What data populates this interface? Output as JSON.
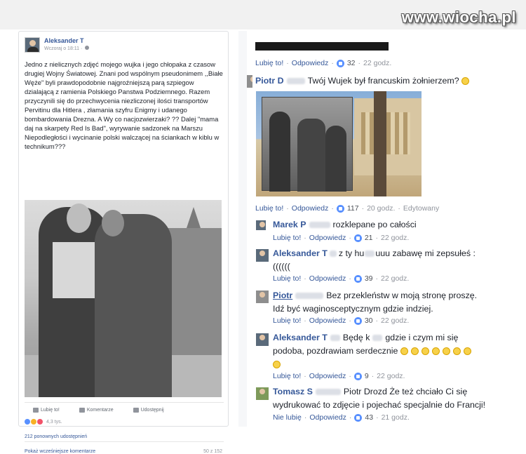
{
  "watermark": "www.wiocha.pl",
  "post": {
    "author": "Aleksander T",
    "time": "Wczoraj o 18:11 · ",
    "text": "Jedno z nielicznych zdjęć mojego wujka i jego chłopaka z czasow drugiej Wojny Światowej. Znani pod wspólnym pseudonimem ,,Białe Węże\" byli prawdopodobnie najgroźniejszą parą szpiegow dzialającą z ramienia Polskiego Panstwa Podziemnego. Razem przyczynili się do przechwycenia niezliczonej ilości transportów Pervitinu dla Hitlera , złamania szyfru Enigmy i udanego bombardowania Drezna. A Wy co nacjozwierzaki? ?? Dalej \"mama daj na skarpety Red Is Bad\", wyrywanie sadzonek na Marszu Niepodległości i wycinanie polski walczącej na ściankach w kiblu w technikum???",
    "actions": {
      "like": "Lubię to!",
      "comment": "Komentarze",
      "share": "Udostępnij"
    },
    "reactions": "4,3 tys.",
    "shares": "212 ponownych udostępnień",
    "more_comments": "Pokaż wcześniejsze komentarze",
    "pager": "50 z 152"
  },
  "comments": {
    "top_meta": {
      "like": "Lubię to!",
      "reply": "Odpowiedz",
      "count": "32",
      "time": "22 godz."
    },
    "c1": {
      "name": "Piotr D",
      "text": "Twój Wujek był francuskim żołnierzem? ",
      "meta": {
        "like": "Lubię to!",
        "reply": "Odpowiedz",
        "count": "117",
        "time": "20 godz.",
        "edited": "Edytowany"
      }
    },
    "c2": {
      "name": "Marek P",
      "text": "rozklepane po całości",
      "meta": {
        "like": "Lubię to!",
        "reply": "Odpowiedz",
        "count": "21",
        "time": "22 godz."
      }
    },
    "c3": {
      "name": "Aleksander T",
      "text_a": "z ty hu",
      "text_b": "uuu zabawę mi zepsułeś :",
      "text_c": "((((((",
      "meta": {
        "like": "Lubię to!",
        "reply": "Odpowiedz",
        "count": "39",
        "time": "22 godz."
      }
    },
    "c4": {
      "name": "Piotr",
      "text": "Bez przekleństw w moją stronę proszę.",
      "text2": "Idź być waginosceptycznym gdzie indziej.",
      "meta": {
        "like": "Lubię to!",
        "reply": "Odpowiedz",
        "count": "30",
        "time": "22 godz."
      }
    },
    "c5": {
      "name": "Aleksander T",
      "text_a": "Będę k",
      "text_b": "gdzie i czym mi się",
      "text2": "podoba, pozdrawiam serdecznie",
      "meta": {
        "like": "Lubię to!",
        "reply": "Odpowiedz",
        "count": "9",
        "time": "22 godz."
      }
    },
    "c6": {
      "name": "Tomasz S",
      "text": "Piotr Drozd Że też chciało Ci się",
      "text2": "wydrukować to zdjęcie i pojechać specjalnie do Francji!",
      "meta": {
        "like": "Nie lubię",
        "reply": "Odpowiedz",
        "count": "43",
        "time": "21 godz."
      }
    }
  }
}
